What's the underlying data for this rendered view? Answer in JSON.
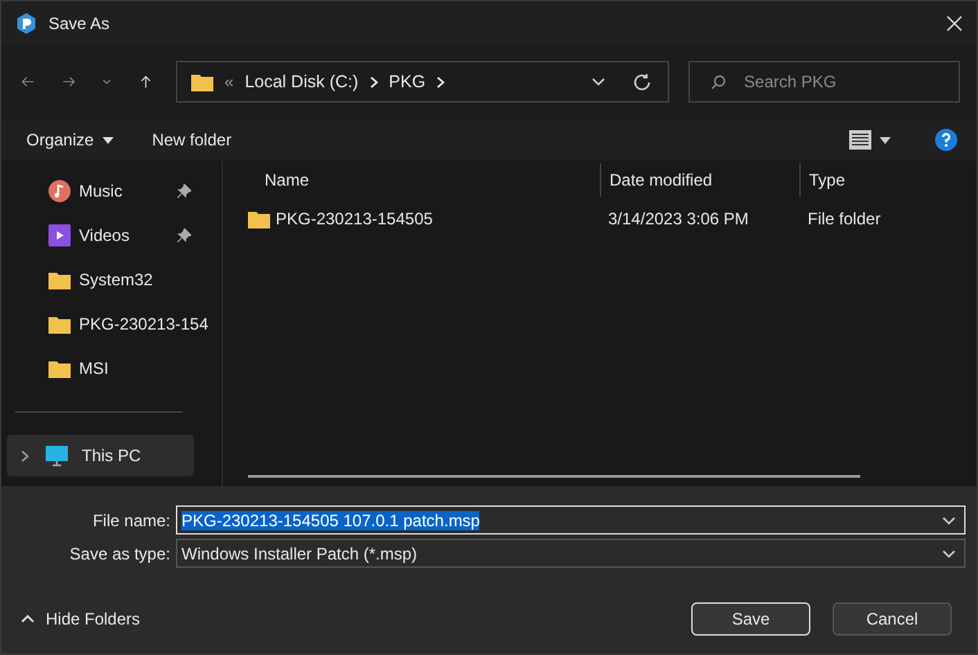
{
  "window": {
    "title": "Save As"
  },
  "address": {
    "overflow": "«",
    "crumbs": [
      "Local Disk (C:)",
      "PKG"
    ],
    "search_placeholder": "Search PKG"
  },
  "toolbar": {
    "organize": "Organize",
    "new_folder": "New folder"
  },
  "sidebar": {
    "items": [
      {
        "kind": "music",
        "label": "Music",
        "pinned": true,
        "selected": false
      },
      {
        "kind": "video",
        "label": "Videos",
        "pinned": true,
        "selected": false
      },
      {
        "kind": "folder",
        "label": "System32",
        "pinned": false,
        "selected": false
      },
      {
        "kind": "folder",
        "label": "PKG-230213-154",
        "pinned": false,
        "selected": false
      },
      {
        "kind": "folder",
        "label": "MSI",
        "pinned": false,
        "selected": false
      },
      {
        "kind": "pc",
        "label": "This PC",
        "pinned": false,
        "selected": true
      }
    ]
  },
  "table": {
    "columns": [
      "Name",
      "Date modified",
      "Type"
    ],
    "rows": [
      {
        "name": "PKG-230213-154505",
        "date": "3/14/2023 3:06 PM",
        "type": "File folder",
        "selected": false
      }
    ]
  },
  "form": {
    "file_name_label": "File name:",
    "file_name": "PKG-230213-154505 107.0.1 patch.msp",
    "type_label": "Save as type:",
    "type": "Windows Installer Patch (*.msp)"
  },
  "footer": {
    "hide_folders": "Hide Folders",
    "save": "Save",
    "cancel": "Cancel"
  }
}
